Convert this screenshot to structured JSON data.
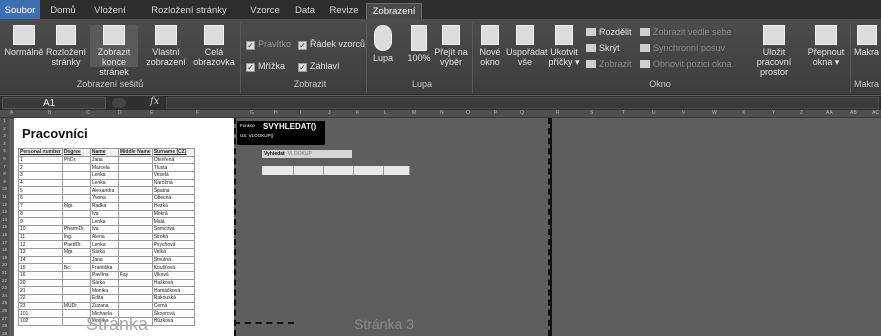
{
  "tabs": [
    "Soubor",
    "Domů",
    "Vložení",
    "Rozložení stránky",
    "Vzorce",
    "Data",
    "Revize",
    "Zobrazení"
  ],
  "ribbon": {
    "normal": "Normálně",
    "layout": "Rozložení stránky",
    "pagebreak": "Zobrazit konce stránek",
    "custom": "Vlastní zobrazení",
    "fullscreen": "Celá obrazovka",
    "group_workbook": "Zobrazení sešitů",
    "ruler": "Pravítko",
    "formulabar": "Řádek vzorců",
    "gridlines": "Mřížka",
    "headings": "Záhlaví",
    "group_show": "Zobrazit",
    "zoom": "Lupa",
    "zoom100": "100%",
    "zoomsel": "Přejít na výběr",
    "group_zoom": "Lupa",
    "newwin": "Nové okno",
    "arrange": "Uspořádat vše",
    "freeze": "Ukotvit příčky",
    "split": "Rozdělit",
    "hide": "Skrýt",
    "unhide": "Zobrazit",
    "sidebyside": "Zobrazit vedle sebe",
    "syncscroll": "Synchronní posuv",
    "resetpos": "Obnovit pozici okna",
    "group_window": "Okno",
    "save_ws": "Uložit pracovní prostor",
    "switch": "Přepnout okna",
    "macros": "Makra",
    "group_macros": "Makra"
  },
  "namebox": "A1",
  "fx": "fx",
  "columns": [
    "A",
    "B",
    "C",
    "D",
    "E",
    "F",
    "G",
    "H",
    "I",
    "J",
    "K",
    "L",
    "M",
    "N",
    "O",
    "P",
    "Q",
    "R",
    "S",
    "T",
    "U",
    "V",
    "W",
    "X",
    "Y",
    "Z",
    "AA",
    "AB",
    "AC"
  ],
  "rows": [
    "1",
    "2",
    "3",
    "4",
    "5",
    "6",
    "7",
    "8",
    "9",
    "10",
    "11",
    "12",
    "13",
    "14",
    "15",
    "16",
    "17",
    "18",
    "19",
    "20",
    "21",
    "22",
    "23",
    "24",
    "25",
    "26",
    "27",
    "28",
    "29"
  ],
  "sheet": {
    "title": "Pracovníci",
    "headers": [
      "Personal number",
      "Degree",
      "Name",
      "Middle Name",
      "Surname (CZ)"
    ],
    "rows": [
      [
        "1",
        "PhDr.",
        "Jana",
        "",
        "Otevřená"
      ],
      [
        "2",
        "",
        "Marcela",
        "",
        "Tlustá"
      ],
      [
        "3",
        "",
        "Lenka",
        "",
        "Veselá"
      ],
      [
        "4",
        "",
        "Lenka",
        "",
        "Nárožná"
      ],
      [
        "5",
        "",
        "Alexandra",
        "",
        "Špatná"
      ],
      [
        "6",
        "",
        "Yvona",
        "",
        "Obecná"
      ],
      [
        "7",
        "Mgr.",
        "Radka",
        "",
        "Hezká"
      ],
      [
        "8",
        "",
        "Iva",
        "",
        "Mokrá"
      ],
      [
        "9",
        "",
        "Lenka",
        "",
        "Malá"
      ],
      [
        "10",
        "PharmDr.",
        "Iva",
        "",
        "Samcová"
      ],
      [
        "11",
        "Ing.",
        "Alena",
        "",
        "Široká"
      ],
      [
        "12",
        "PaedDr.",
        "Lenka",
        "",
        "Psychová"
      ],
      [
        "13",
        "Mgr.",
        "Šárka",
        "",
        "Velká"
      ],
      [
        "14",
        "",
        "Jana",
        "",
        "Smutná"
      ],
      [
        "15",
        "Bc.",
        "Františka",
        "",
        "Koušťová"
      ],
      [
        "16",
        "",
        "Pavlína",
        "Fay",
        "Vlková"
      ],
      [
        "20",
        "",
        "Šárka",
        "",
        "Hašková"
      ],
      [
        "21",
        "",
        "Monika",
        "",
        "Hamáčková"
      ],
      [
        "22",
        "",
        "Edita",
        "",
        "Rakouská"
      ],
      [
        "23",
        "MUDr.",
        "Zuzana",
        "",
        "Černá"
      ],
      [
        "101",
        "",
        "Michaela",
        "",
        "Škoprová"
      ],
      [
        "102",
        "",
        "Monika",
        "",
        "Hůzková"
      ]
    ],
    "watermark1": "Stránka",
    "watermark2": "Stránka 3"
  },
  "funcbox": {
    "label": "Funkce",
    "name": "SVYHLEDAT()",
    "alt": "US: VLOOKUP()"
  },
  "vyhl": {
    "cz": "Vyhledat",
    "en": "VLOOKUP"
  }
}
